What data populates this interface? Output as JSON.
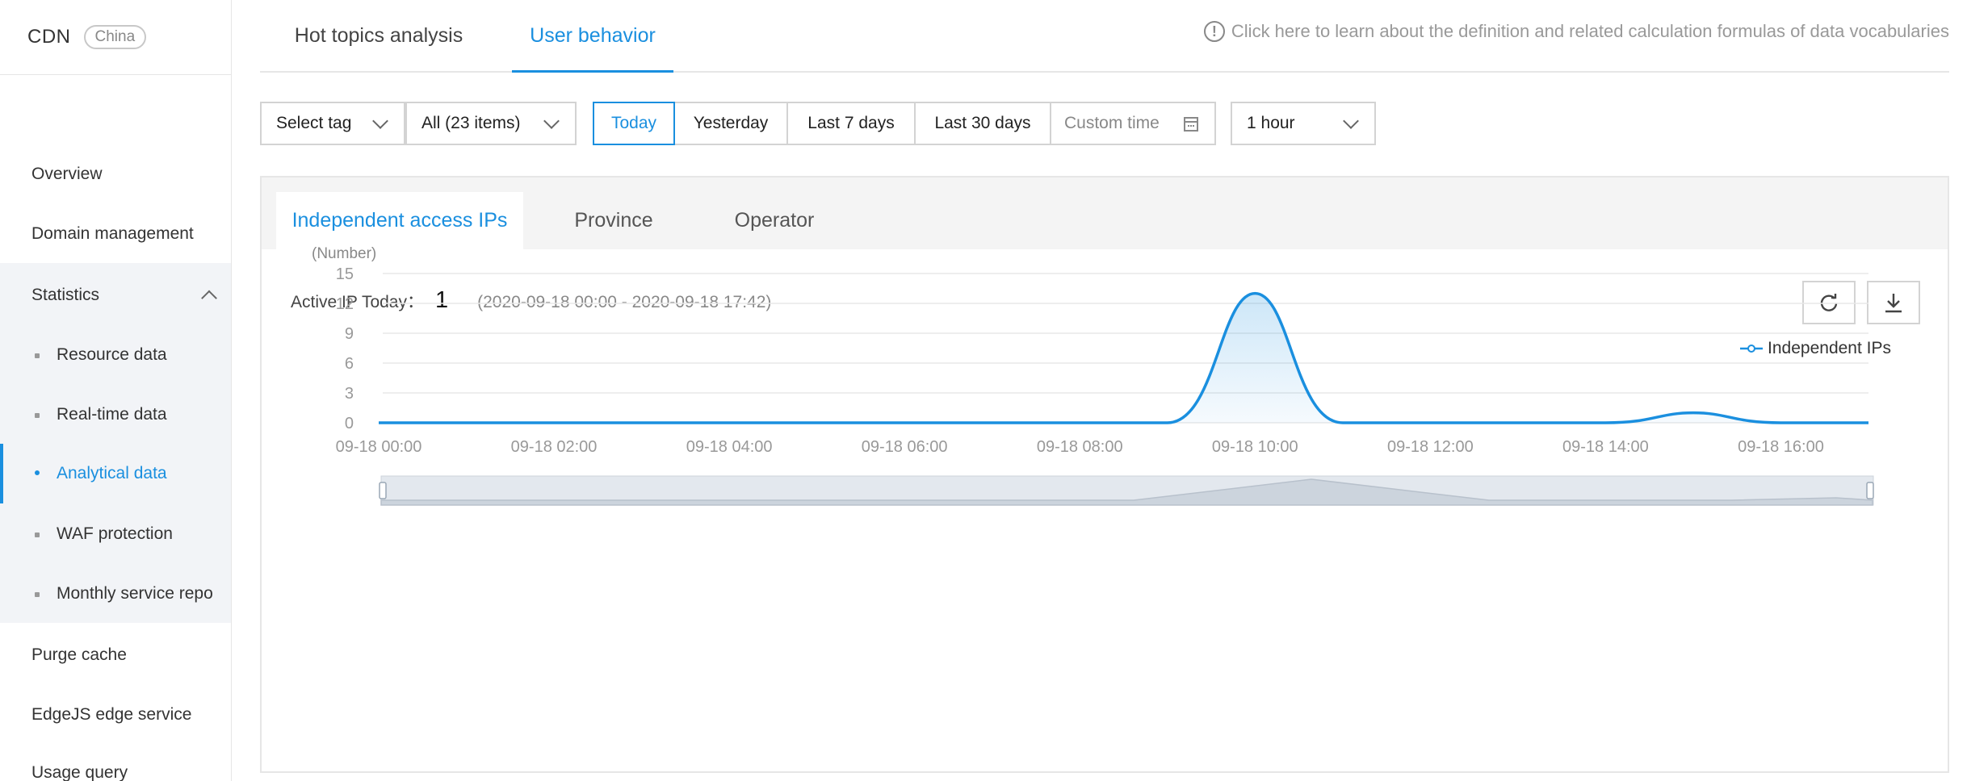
{
  "sidebar": {
    "brand": "CDN",
    "region": "China",
    "items": [
      {
        "label": "Overview"
      },
      {
        "label": "Domain management"
      },
      {
        "label": "Statistics"
      },
      {
        "label": "Purge cache"
      },
      {
        "label": "EdgeJS edge service"
      },
      {
        "label": "Usage query"
      }
    ],
    "sub_items": [
      {
        "label": "Resource data"
      },
      {
        "label": "Real-time data"
      },
      {
        "label": "Analytical data",
        "active": true
      },
      {
        "label": "WAF protection"
      },
      {
        "label": "Monthly service repo"
      }
    ]
  },
  "top_tabs": [
    {
      "label": "Hot topics analysis"
    },
    {
      "label": "User behavior",
      "active": true
    }
  ],
  "help_text": "Click here to learn about the definition and related calculation formulas of data vocabularies",
  "filters": {
    "tag_select": "Select tag",
    "items_select": "All (23 items)",
    "time_ranges": [
      "Today",
      "Yesterday",
      "Last 7 days",
      "Last 30 days"
    ],
    "active_range": "Today",
    "custom_time": "Custom time",
    "granularity": "1 hour"
  },
  "panel_tabs": [
    {
      "label": "Independent access IPs",
      "active": true
    },
    {
      "label": "Province"
    },
    {
      "label": "Operator"
    }
  ],
  "summary": {
    "label": "Active IP Today：",
    "value": "1",
    "range": "(2020-09-18 00:00 - 2020-09-18 17:42)"
  },
  "icons": {
    "refresh": "refresh-icon",
    "download": "download-icon",
    "help": "info-circle-icon",
    "calendar": "calendar-icon"
  },
  "colors": {
    "accent": "#1a8fdf",
    "series": "#1a8fdf"
  },
  "chart_data": {
    "type": "line",
    "unit_label": "(Number)",
    "xlabel": "",
    "ylabel": "",
    "legend": "top-right",
    "grid": true,
    "ylim": [
      0,
      15
    ],
    "y_ticks": [
      "0",
      "3",
      "6",
      "9",
      "12",
      "15"
    ],
    "x": [
      "09-18 00:00",
      "09-18 01:00",
      "09-18 02:00",
      "09-18 03:00",
      "09-18 04:00",
      "09-18 05:00",
      "09-18 06:00",
      "09-18 07:00",
      "09-18 08:00",
      "09-18 09:00",
      "09-18 10:00",
      "09-18 11:00",
      "09-18 12:00",
      "09-18 13:00",
      "09-18 14:00",
      "09-18 15:00",
      "09-18 16:00",
      "09-18 17:00"
    ],
    "x_ticks": [
      "09-18 00:00",
      "09-18 02:00",
      "09-18 04:00",
      "09-18 06:00",
      "09-18 08:00",
      "09-18 10:00",
      "09-18 12:00",
      "09-18 14:00",
      "09-18 16:00"
    ],
    "series": [
      {
        "name": "Independent IPs",
        "values": [
          0,
          0,
          0,
          0,
          0,
          0,
          0,
          0,
          0,
          0,
          13,
          0,
          0,
          0,
          0,
          1,
          0,
          0
        ]
      }
    ]
  }
}
